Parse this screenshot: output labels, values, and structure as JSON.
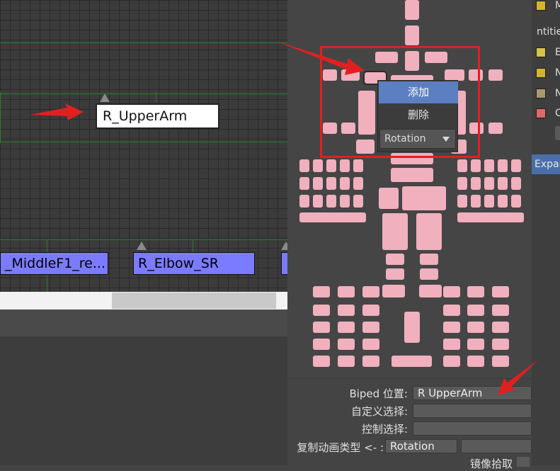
{
  "graph": {
    "selected_name": "R_UpperArm",
    "nodes": [
      "_MiddleF1_re...",
      "R_Elbow_SR",
      "..."
    ]
  },
  "context_menu": {
    "add_label": "添加",
    "delete_label": "删除",
    "rotation_value": "Rotation"
  },
  "form": {
    "biped_pos_label": "Biped 位置:",
    "biped_pos_value": "R UpperArm",
    "custom_select_label": "自定义选择:",
    "custom_select_value": "",
    "control_select_label": "控制选择:",
    "control_select_value": "",
    "copy_anim_label": "复制动画类型 <- :",
    "copy_anim_value": "Rotation",
    "copy_anim_extra": "",
    "mirror_label": "镜像拾取"
  },
  "right_panel": {
    "entities_label": "ntitie",
    "row_labels": [
      "M",
      "E",
      "N",
      "N",
      "C"
    ],
    "chip_colors": [
      "#d6b52e",
      "#d6c24a",
      "#d1b530",
      "#a89a70",
      "#e06a6a"
    ],
    "expand_label": "Expan"
  },
  "colors": {
    "body_part": "#f0b0be",
    "node": "#7b7bff",
    "menu_highlight": "#5b7fc0",
    "annotation_red": "#e02020"
  }
}
